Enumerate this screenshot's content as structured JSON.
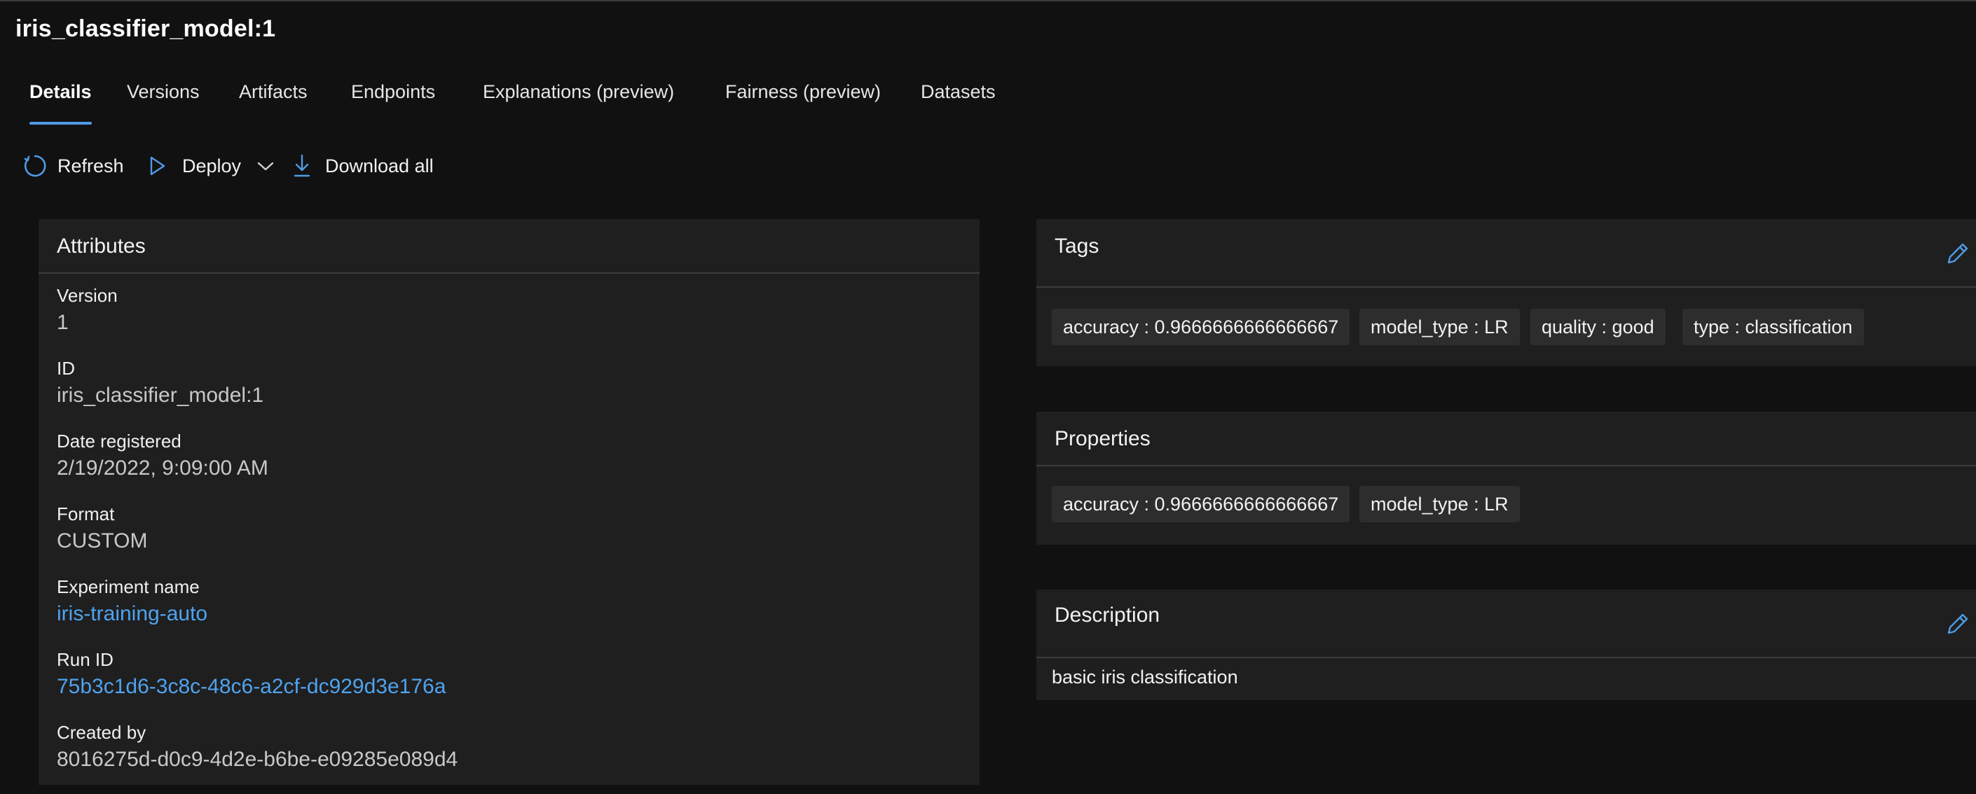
{
  "page": {
    "title": "iris_classifier_model:1"
  },
  "tabs": [
    {
      "label": "Details",
      "active": true
    },
    {
      "label": "Versions"
    },
    {
      "label": "Artifacts"
    },
    {
      "label": "Endpoints"
    },
    {
      "label": "Explanations (preview)"
    },
    {
      "label": "Fairness (preview)"
    },
    {
      "label": "Datasets"
    }
  ],
  "toolbar": {
    "refresh_label": "Refresh",
    "deploy_label": "Deploy",
    "download_label": "Download all",
    "icons": [
      "refresh-icon",
      "play-icon",
      "chevron-down-icon",
      "download-icon"
    ]
  },
  "attributes": {
    "title": "Attributes",
    "items": [
      {
        "label": "Version",
        "value": "1"
      },
      {
        "label": "ID",
        "value": "iris_classifier_model:1"
      },
      {
        "label": "Date registered",
        "value": "2/19/2022, 9:09:00 AM"
      },
      {
        "label": "Format",
        "value": "CUSTOM"
      },
      {
        "label": "Experiment name",
        "value": "iris-training-auto",
        "link": true
      },
      {
        "label": "Run ID",
        "value": "75b3c1d6-3c8c-48c6-a2cf-dc929d3e176a",
        "link": true
      },
      {
        "label": "Created by",
        "value": "8016275d-d0c9-4d2e-b6be-e09285e089d4"
      }
    ]
  },
  "tags": {
    "title": "Tags",
    "items": [
      "accuracy : 0.9666666666666667",
      "model_type : LR",
      "quality : good",
      "type : classification"
    ]
  },
  "properties": {
    "title": "Properties",
    "items": [
      "accuracy : 0.9666666666666667",
      "model_type : LR"
    ]
  },
  "description": {
    "title": "Description",
    "text": "basic iris classification"
  },
  "colors": {
    "background": "#111112",
    "card": "#1f1f1f",
    "chip": "#2d2d2d",
    "accent": "#4f9be6",
    "link": "#4fa3ef"
  }
}
